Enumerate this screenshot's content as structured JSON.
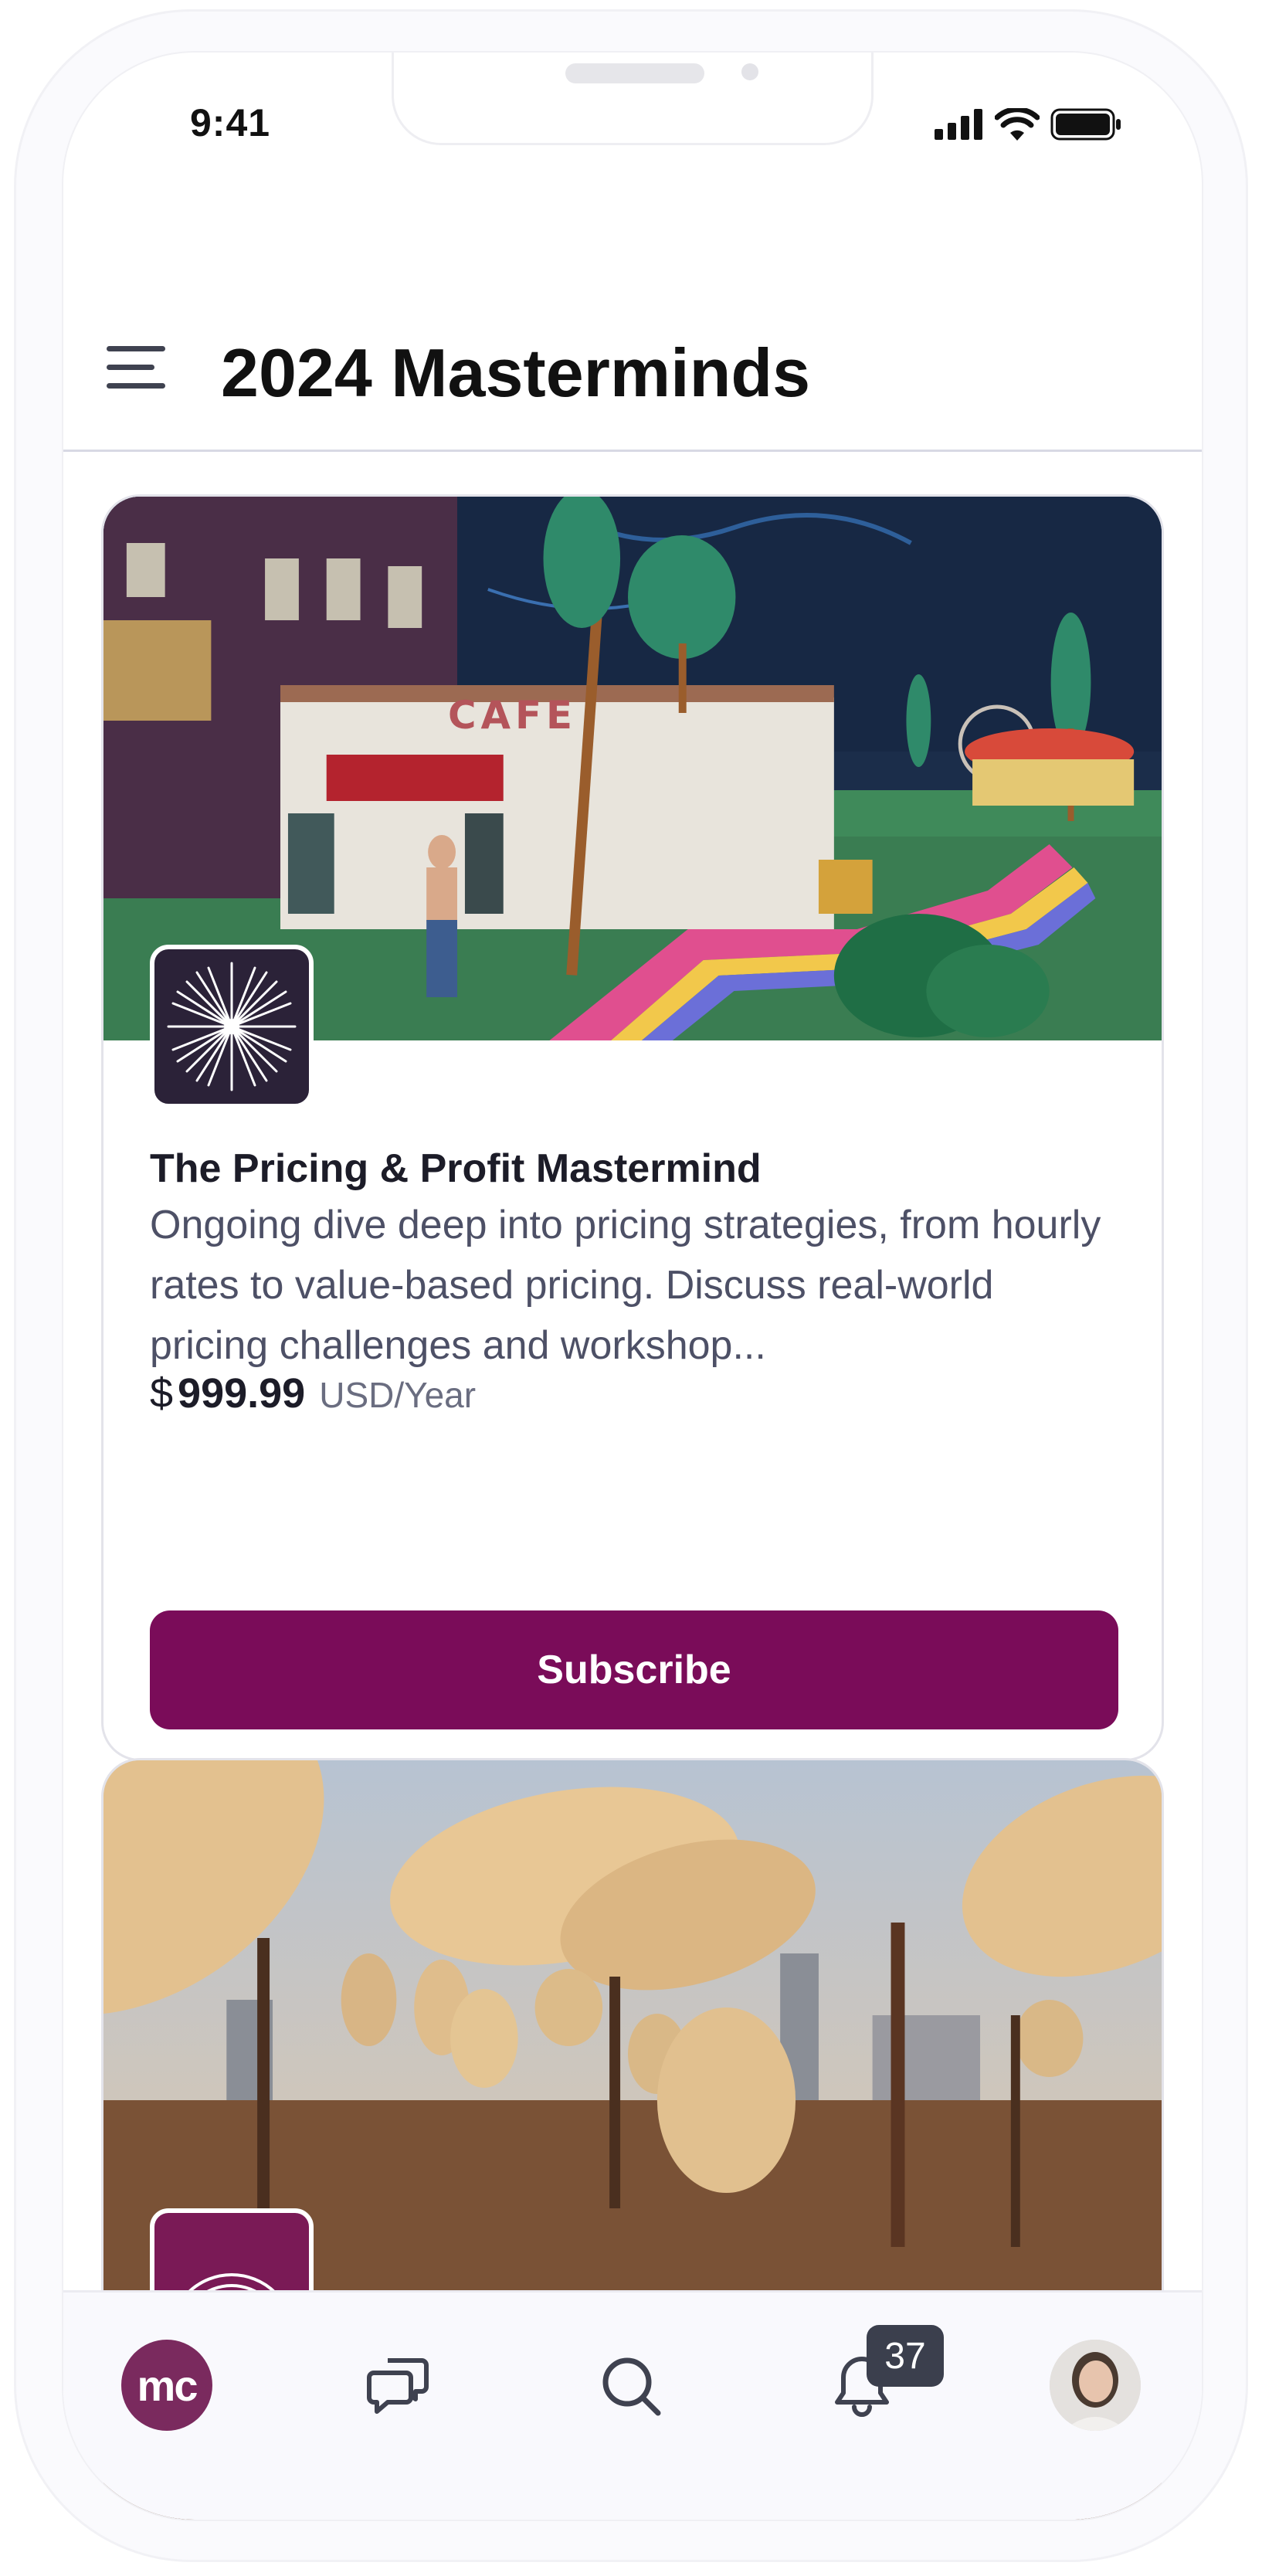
{
  "status_bar": {
    "time": "9:41"
  },
  "header": {
    "title": "2024 Masterminds",
    "menu_icon": "hamburger-menu-icon"
  },
  "cards": [
    {
      "title": "The Pricing & Profit Mastermind",
      "description": "Ongoing dive deep into pricing strategies, from hourly rates to value-based pricing. Discuss real-world pricing challenges and workshop...",
      "price": {
        "currency": "$",
        "amount": "999.99",
        "period": "USD/Year"
      },
      "button_label": "Subscribe",
      "image_sign_text": "CAFE"
    },
    {
      "title": "",
      "image_subject": "satellite dishes on rooftop"
    }
  ],
  "bottom_nav": {
    "items": [
      "home",
      "chat",
      "search",
      "notifications",
      "profile"
    ],
    "home_logo": "mc",
    "notifications_badge": "37"
  },
  "colors": {
    "accent": "#7a0c59",
    "text": "#1c1c28",
    "muted": "#4d5066",
    "badge": "#3b3f4d"
  }
}
